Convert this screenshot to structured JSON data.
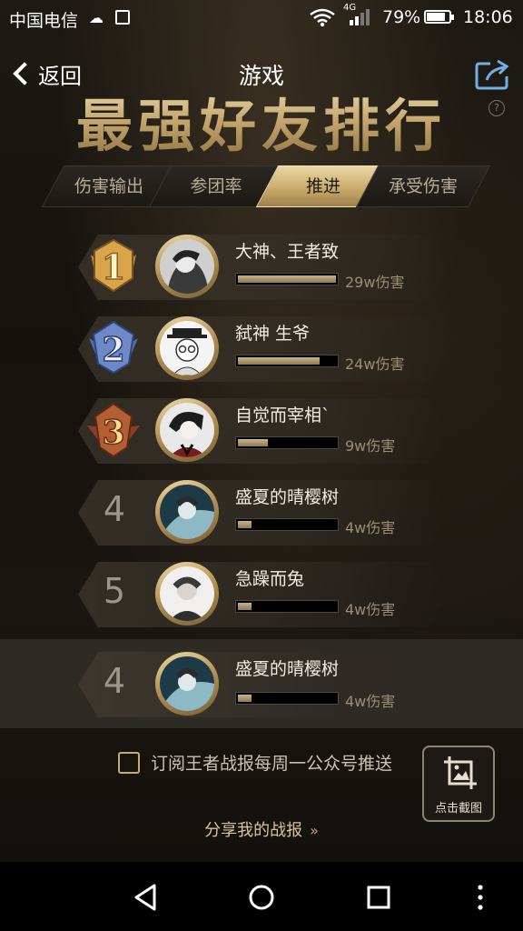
{
  "status_bar": {
    "carrier": "中国电信",
    "network": "4G",
    "battery": "79%",
    "time": "18:06"
  },
  "header": {
    "back_label": "返回",
    "title": "游戏",
    "banner": "最强好友排行"
  },
  "tabs": [
    {
      "label": "伤害输出",
      "active": false
    },
    {
      "label": "参团率",
      "active": false
    },
    {
      "label": "推进",
      "active": true
    },
    {
      "label": "承受伤害",
      "active": false
    }
  ],
  "ranking": [
    {
      "rank": "1",
      "name": "大神、王者致",
      "value": "29w伤害",
      "progress": 1.0,
      "medal": "gold"
    },
    {
      "rank": "2",
      "name": "弑神 生爷",
      "value": "24w伤害",
      "progress": 0.83,
      "medal": "silver"
    },
    {
      "rank": "3",
      "name": "自觉而宰相`",
      "value": "9w伤害",
      "progress": 0.31,
      "medal": "bronze"
    },
    {
      "rank": "4",
      "name": "盛夏的晴樱树",
      "value": "4w伤害",
      "progress": 0.14,
      "medal": "none"
    },
    {
      "rank": "5",
      "name": "急躁而兔",
      "value": "4w伤害",
      "progress": 0.14,
      "medal": "none"
    }
  ],
  "my_rank": {
    "rank": "4",
    "name": "盛夏的晴樱树",
    "value": "4w伤害",
    "progress": 0.14
  },
  "subscribe_label": "订阅王者战报每周一公众号推送",
  "screenshot_label": "点击截图",
  "share_report_label": "分享我的战报",
  "share_report_arrows": "»",
  "colors": {
    "gold": "#c9b387",
    "background": "#14110d"
  }
}
